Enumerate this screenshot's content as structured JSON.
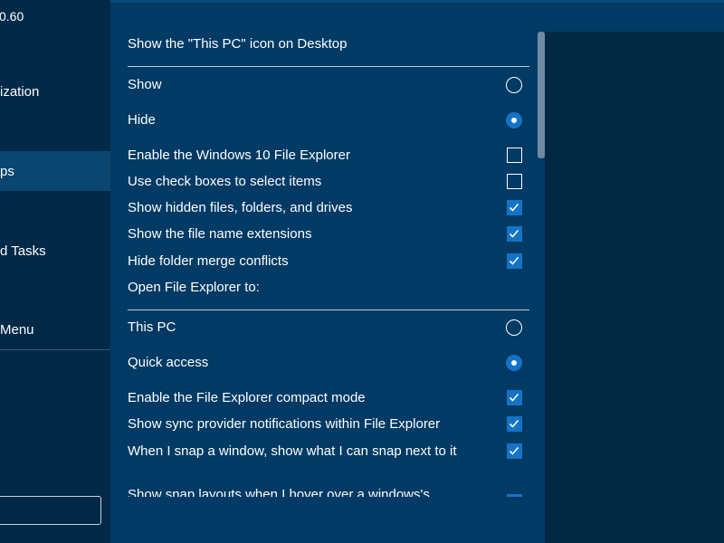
{
  "sidebar": {
    "version": "0.60",
    "items": [
      {
        "label": "ization"
      },
      {
        "label": "ps"
      },
      {
        "label": "d Tasks"
      },
      {
        "label": "Menu"
      }
    ]
  },
  "this_pc_section": {
    "title": "Show the \"This PC\" icon on Desktop",
    "options": [
      {
        "label": "Show",
        "selected": false
      },
      {
        "label": "Hide",
        "selected": true
      }
    ]
  },
  "checkboxes_1": [
    {
      "label": "Enable the Windows 10 File Explorer",
      "checked": false
    },
    {
      "label": "Use check boxes to select items",
      "checked": false
    },
    {
      "label": "Show hidden files, folders, and drives",
      "checked": true
    },
    {
      "label": "Show the file name extensions",
      "checked": true
    },
    {
      "label": "Hide folder merge conflicts",
      "checked": true
    }
  ],
  "open_explorer_section": {
    "title": "Open File Explorer to:",
    "options": [
      {
        "label": "This PC",
        "selected": false
      },
      {
        "label": "Quick access",
        "selected": true
      }
    ]
  },
  "checkboxes_2": [
    {
      "label": "Enable the File Explorer compact mode",
      "checked": true
    },
    {
      "label": "Show sync provider notifications within File Explorer",
      "checked": true
    },
    {
      "label": "When I snap a window, show what I can snap next to it",
      "checked": true
    },
    {
      "label": "Show snap layouts when I hover over a windows's",
      "checked": true
    }
  ],
  "colors": {
    "accent": "#1473c6",
    "content_bg": "#013a64",
    "sidebar_bg": "#022a48"
  }
}
